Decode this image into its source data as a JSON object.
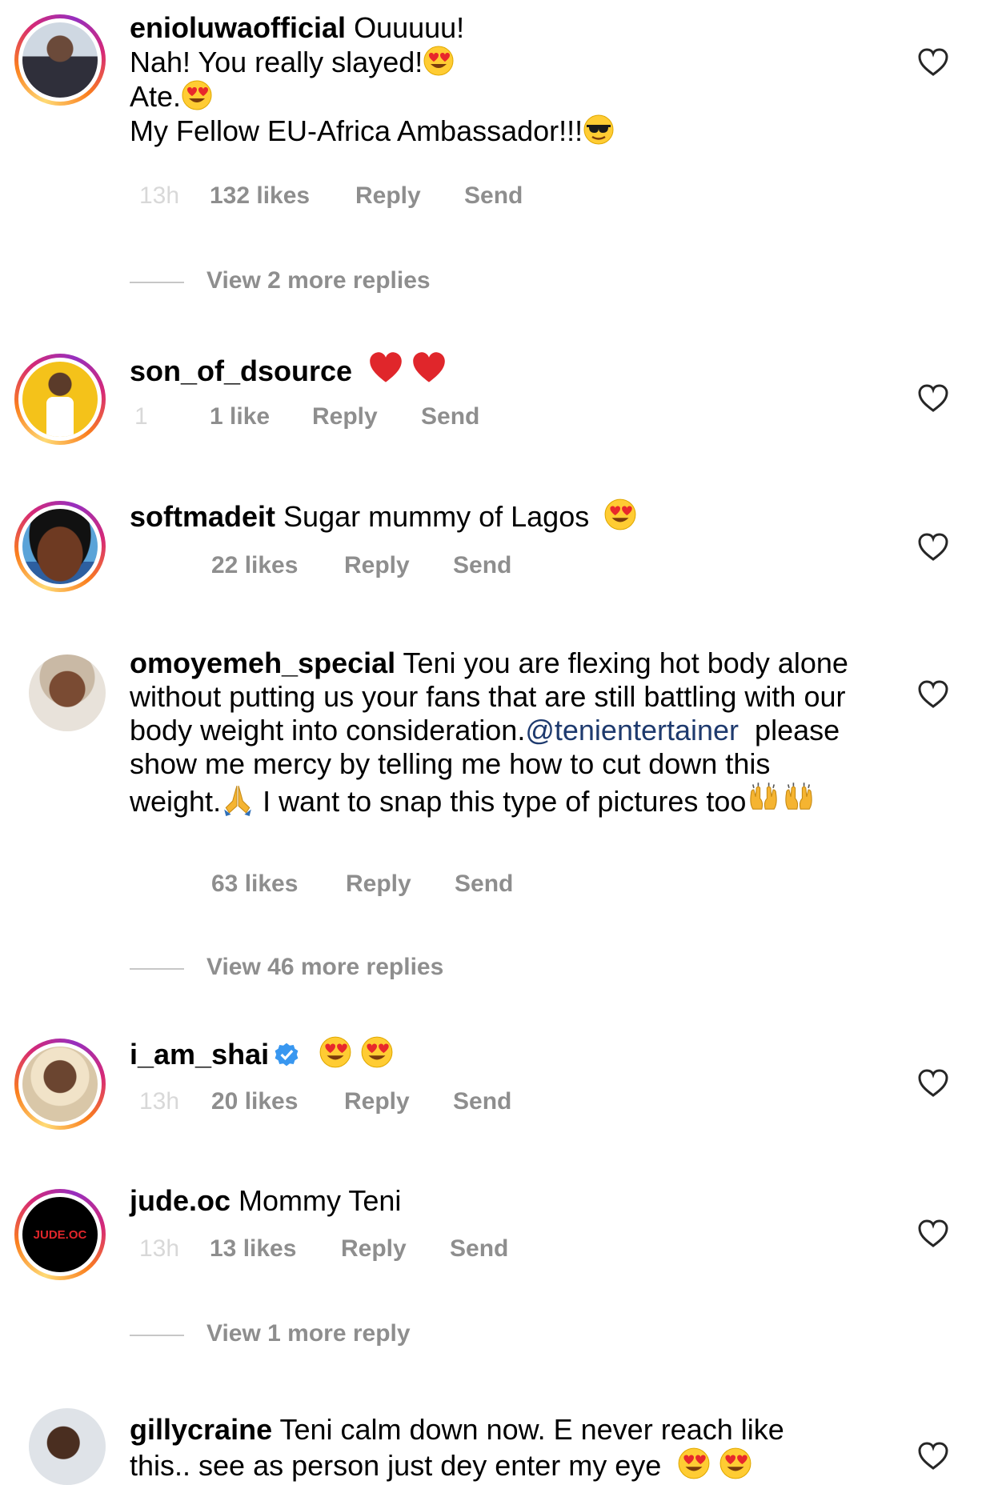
{
  "comments": [
    {
      "username": "enioluwaofficial",
      "text_lines": [
        "Ouuuuu!",
        "Nah! You really slayed!",
        "Ate.",
        "My Fellow EU-Africa Ambassador!!!"
      ],
      "time": "13h",
      "likes": "132 likes",
      "reply": "Reply",
      "send": "Send"
    },
    {
      "username": "son_of_dsource",
      "time": "1",
      "likes": "1 like",
      "reply": "Reply",
      "send": "Send"
    },
    {
      "username": "softmadeit",
      "text": "Sugar mummy of Lagos",
      "likes": "22 likes",
      "reply": "Reply",
      "send": "Send"
    },
    {
      "username": "omoyemeh_special",
      "text_a": "Teni you are flexing hot body alone without putting us your fans that are still battling with our body weight into consideration.",
      "mention": "@tenientertainer",
      "text_b": "please show me mercy by telling me how to cut down this weight.",
      "text_c": "I want to snap this type of pictures too",
      "likes": "63 likes",
      "reply": "Reply",
      "send": "Send"
    },
    {
      "username": "i_am_shai",
      "time": "13h",
      "likes": "20 likes",
      "reply": "Reply",
      "send": "Send"
    },
    {
      "username": "jude.oc",
      "avatar_text": "JUDE.OC",
      "text": "Mommy Teni",
      "time": "13h",
      "likes": "13 likes",
      "reply": "Reply",
      "send": "Send"
    },
    {
      "username": "gillycraine",
      "text_a": "Teni calm down now. E never reach like",
      "text_b": "this.. see as person just dey enter my eye"
    }
  ],
  "view_replies": [
    "View 2 more replies",
    "View 46 more replies",
    "View 1 more reply"
  ],
  "colors": {
    "meta_gray": "#8e8e8e",
    "mention_blue": "#1e3a6e",
    "verified_blue": "#3897f0",
    "ring_gradient": [
      "#feda75",
      "#fa7e1e",
      "#d62976",
      "#962fbf"
    ]
  },
  "icons": [
    "heart-outline-icon",
    "verified-badge-icon",
    "heart-eyes-emoji",
    "sunglasses-emoji",
    "red-heart-emoji",
    "praying-hands-emoji",
    "raising-hands-emoji"
  ]
}
